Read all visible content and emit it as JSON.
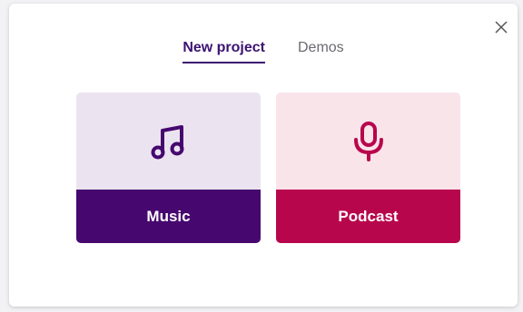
{
  "dialog": {
    "close_icon": "close-icon"
  },
  "tabs": [
    {
      "label": "New project",
      "active": true
    },
    {
      "label": "Demos",
      "active": false
    }
  ],
  "cards": [
    {
      "label": "Music",
      "icon": "music-note-icon",
      "color": "#46086f",
      "light": "#ebe4f0"
    },
    {
      "label": "Podcast",
      "icon": "microphone-icon",
      "color": "#b8064c",
      "light": "#f9e4ea"
    }
  ]
}
